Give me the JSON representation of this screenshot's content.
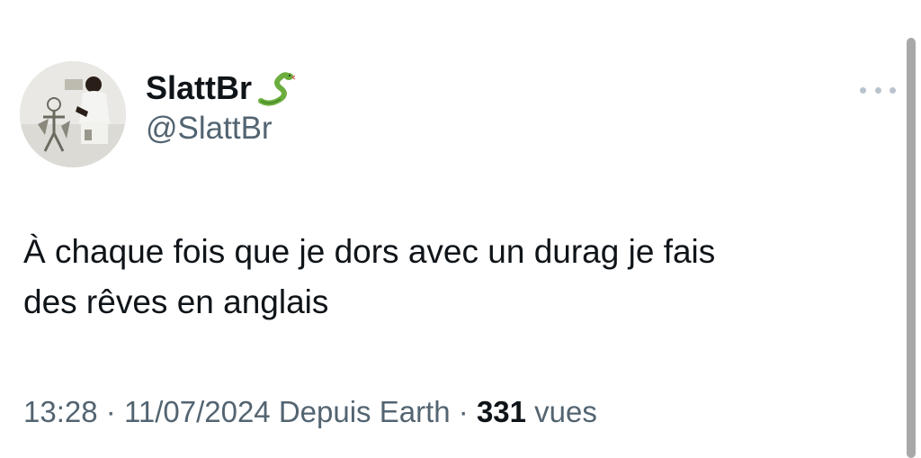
{
  "author": {
    "display_name": "SlattBr",
    "handle": "@SlattBr",
    "avatar": "avatar",
    "name_emoji": "snake-icon"
  },
  "more_menu": {
    "icon": "more-horizontal-icon"
  },
  "tweet": {
    "text_line1": "À chaque fois que je dors avec un durag je fais",
    "text_line2": "des rêves en anglais"
  },
  "meta": {
    "time": "13:28",
    "separator1": "·",
    "date": "11/07/2024",
    "source": "Depuis Earth",
    "separator2": "·",
    "views_count": "331",
    "views_label": "vues"
  },
  "colors": {
    "text_primary": "#0f1419",
    "text_secondary": "#536471",
    "dots": "#b9c3cc",
    "scrollbar": "#a8a8a8"
  }
}
